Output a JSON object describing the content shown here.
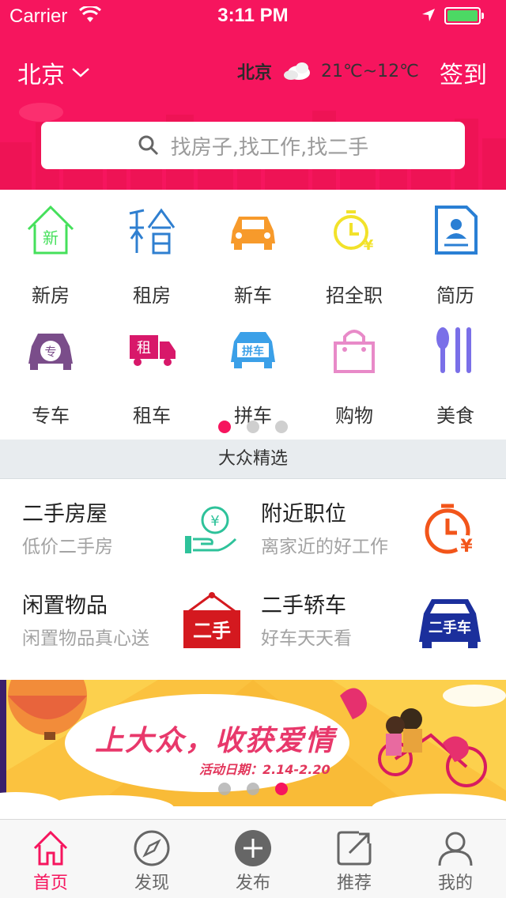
{
  "status_bar": {
    "carrier": "Carrier",
    "time": "3:11 PM"
  },
  "header": {
    "city": "北京",
    "weather_city": "北京",
    "temperature": "21℃~12℃",
    "signin_label": "签到",
    "search_placeholder": "找房子,找工作,找二手",
    "brand_color": "#f6155e"
  },
  "categories": [
    {
      "label": "新房",
      "icon": "new-house-icon"
    },
    {
      "label": "租房",
      "icon": "rent-house-icon"
    },
    {
      "label": "新车",
      "icon": "new-car-icon"
    },
    {
      "label": "招全职",
      "icon": "fulltime-job-icon"
    },
    {
      "label": "简历",
      "icon": "resume-icon"
    },
    {
      "label": "专车",
      "icon": "private-car-icon"
    },
    {
      "label": "租车",
      "icon": "rent-truck-icon"
    },
    {
      "label": "拼车",
      "icon": "carpool-icon"
    },
    {
      "label": "购物",
      "icon": "shopping-bag-icon"
    },
    {
      "label": "美食",
      "icon": "food-utensils-icon"
    }
  ],
  "category_pages": {
    "count": 3,
    "active": 0
  },
  "section_title": "大众精选",
  "featured": [
    {
      "title": "二手房屋",
      "subtitle": "低价二手房",
      "icon": "money-hand-icon"
    },
    {
      "title": "附近职位",
      "subtitle": "离家近的好工作",
      "icon": "clock-yen-icon"
    },
    {
      "title": "闲置物品",
      "subtitle": "闲置物品真心送",
      "icon": "secondhand-sign-icon"
    },
    {
      "title": "二手轿车",
      "subtitle": "好车天天看",
      "icon": "used-car-icon"
    }
  ],
  "banner": {
    "slogan": "上大众，收获爱情",
    "date": "活动日期：2.14-2.20",
    "pages": 3,
    "active": 2
  },
  "tabs": [
    {
      "label": "首页",
      "icon": "home-icon",
      "active": true
    },
    {
      "label": "发现",
      "icon": "compass-icon",
      "active": false
    },
    {
      "label": "发布",
      "icon": "plus-circle-icon",
      "active": false
    },
    {
      "label": "推荐",
      "icon": "share-icon",
      "active": false
    },
    {
      "label": "我的",
      "icon": "user-icon",
      "active": false
    }
  ]
}
